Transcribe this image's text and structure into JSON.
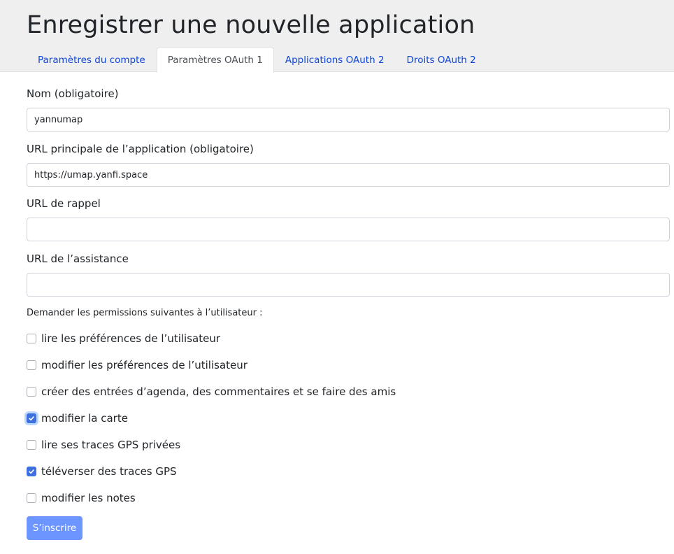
{
  "page_title": "Enregistrer une nouvelle application",
  "tabs": [
    {
      "label": "Paramètres du compte",
      "active": false
    },
    {
      "label": "Paramètres OAuth 1",
      "active": true
    },
    {
      "label": "Applications OAuth 2",
      "active": false
    },
    {
      "label": "Droits OAuth 2",
      "active": false
    }
  ],
  "form": {
    "name": {
      "label": "Nom (obligatoire)",
      "value": "yannumap"
    },
    "main_url": {
      "label": "URL principale de l’application (obligatoire)",
      "value": "https://umap.yanfi.space"
    },
    "callback_url": {
      "label": "URL de rappel",
      "value": ""
    },
    "support_url": {
      "label": "URL de l’assistance",
      "value": ""
    }
  },
  "permissions": {
    "title": "Demander les permissions suivantes à l’utilisateur :",
    "items": [
      {
        "label": "lire les préférences de l’utilisateur",
        "checked": false
      },
      {
        "label": "modifier les préférences de l’utilisateur",
        "checked": false
      },
      {
        "label": "créer des entrées d’agenda, des commentaires et se faire des amis",
        "checked": false
      },
      {
        "label": "modifier la carte",
        "checked": true,
        "focused": true
      },
      {
        "label": "lire ses traces GPS privées",
        "checked": false
      },
      {
        "label": "téléverser des traces GPS",
        "checked": true
      },
      {
        "label": "modifier les notes",
        "checked": false
      }
    ]
  },
  "submit_label": "S’inscrire",
  "colors": {
    "header_bg": "#efefef",
    "link": "#0d47d9",
    "checkbox_checked": "#3d6fe0",
    "button": "#6d95ff"
  }
}
